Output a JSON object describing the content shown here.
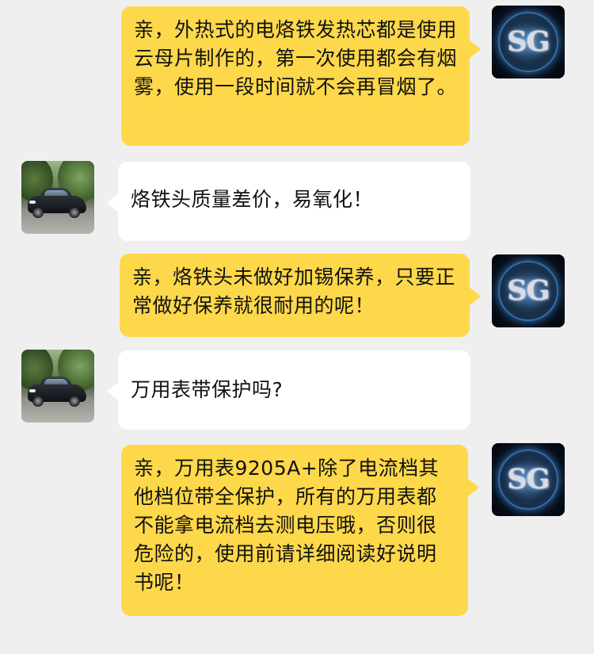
{
  "chat": {
    "messages": [
      {
        "sender": "shop",
        "avatar_text": "SG",
        "text": "亲，外热式的电烙铁发热芯都是使用云母片制作的，第一次使用都会有烟雾，使用一段时间就不会再冒烟了。"
      },
      {
        "sender": "customer",
        "avatar_icon": "car-photo",
        "text": "烙铁头质量差价，易氧化！"
      },
      {
        "sender": "shop",
        "avatar_text": "SG",
        "text": "亲，烙铁头未做好加锡保养，只要正常做好保养就很耐用的呢！"
      },
      {
        "sender": "customer",
        "avatar_icon": "car-photo",
        "text": "万用表带保护吗?"
      },
      {
        "sender": "shop",
        "avatar_text": "SG",
        "text": "亲，万用表9205A+除了电流档其他档位带全保护，所有的万用表都不能拿电流档去测电压哦，否则很危险的，使用前请详细阅读好说明书呢！"
      }
    ]
  },
  "colors": {
    "background": "#efefef",
    "shop_bubble": "#fdd84a",
    "customer_bubble": "#ffffff"
  }
}
